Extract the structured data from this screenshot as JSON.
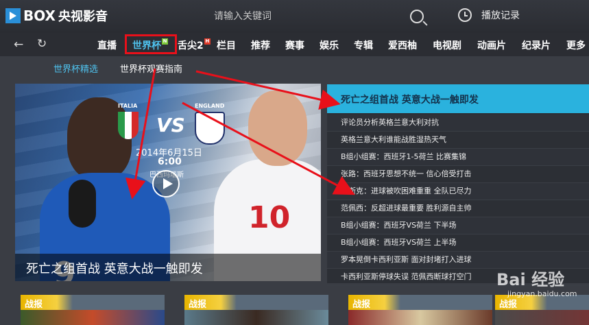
{
  "app": {
    "logo_box": "BOX",
    "logo_cn": "央视影音"
  },
  "search": {
    "placeholder": "请输入关键词"
  },
  "history": {
    "label": "播放记录"
  },
  "nav": {
    "items": [
      {
        "label": "直播"
      },
      {
        "label": "世界杯",
        "badge": "N"
      },
      {
        "label": "舌尖2",
        "badge": "H"
      },
      {
        "label": "栏目"
      },
      {
        "label": "推荐"
      },
      {
        "label": "赛事"
      },
      {
        "label": "娱乐"
      },
      {
        "label": "专辑"
      },
      {
        "label": "爱西柚"
      },
      {
        "label": "电视剧"
      },
      {
        "label": "动画片"
      },
      {
        "label": "纪录片"
      },
      {
        "label": "更多"
      }
    ]
  },
  "subnav": {
    "items": [
      {
        "label": "世界杯精选"
      },
      {
        "label": "世界杯观赛指南"
      }
    ]
  },
  "hero": {
    "team_left": "ITALIA",
    "team_right": "ENGLAND",
    "vs": "VS",
    "date": "2014年6月15日",
    "time": "6:00",
    "venue": "巴西玛瑙斯",
    "caption": "死亡之组首战 英意大战一触即发",
    "num_left": "9",
    "num_right": "10"
  },
  "side": {
    "title": "死亡之组首战 英意大战一触即发",
    "items": [
      "评论员分析英格兰意大利对抗",
      "英格兰意大利谁能战胜湿热天气",
      "B组小组赛：西班牙1-5荷兰 比赛集锦",
      "张路：西班牙思想不统一 信心倍受打击",
      "博斯克：进球被吹困难重重 全队已尽力",
      "范佩西：反超进球最重要 胜利源自主帅",
      "B组小组赛：西班牙VS荷兰 下半场",
      "B组小组赛：西班牙VS荷兰 上半场",
      "罗本晃倒卡西利亚斯 面对封堵打入进球",
      "卡西利亚斯停球失误 范佩西断球打空门"
    ]
  },
  "cards": [
    {
      "tag": "战报"
    },
    {
      "tag": "战报"
    },
    {
      "tag": "战报"
    },
    {
      "tag": "战报"
    }
  ],
  "watermark": {
    "text": "Bai 经验",
    "sub": "jingyan.baidu.com"
  },
  "colors": {
    "accent": "#2ab2de",
    "highlight_box": "#e8101a",
    "annotation_arrow": "#e8101a"
  }
}
